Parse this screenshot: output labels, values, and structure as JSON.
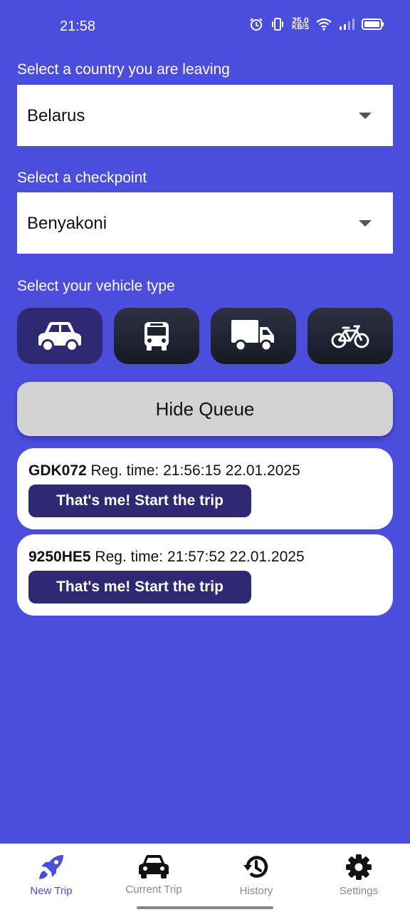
{
  "status": {
    "time": "21:58",
    "net_speed_value": "25.0",
    "net_speed_unit": "KB/S"
  },
  "country": {
    "label": "Select a country you are leaving",
    "value": "Belarus"
  },
  "checkpoint": {
    "label": "Select a checkpoint",
    "value": "Benyakoni"
  },
  "vehicle": {
    "label": "Select your vehicle type",
    "options": [
      "car",
      "bus",
      "truck",
      "bicycle"
    ],
    "selected": "car"
  },
  "queue_toggle_label": "Hide Queue",
  "queue": [
    {
      "plate": "GDK072",
      "reg_time": "Reg. time: 21:56:15 22.01.2025",
      "button": "That's me! Start the trip"
    },
    {
      "plate": "9250HE5",
      "reg_time": "Reg. time: 21:57:52 22.01.2025",
      "button": "That's me! Start the trip"
    }
  ],
  "nav": {
    "items": [
      {
        "label": "New Trip",
        "icon": "rocket-icon",
        "active": true
      },
      {
        "label": "Current Trip",
        "icon": "car-icon",
        "active": false
      },
      {
        "label": "History",
        "icon": "history-icon",
        "active": false
      },
      {
        "label": "Settings",
        "icon": "gear-icon",
        "active": false
      }
    ]
  },
  "colors": {
    "background": "#4b4ddd",
    "accent": "#2f2872",
    "inactive": "#888888"
  }
}
